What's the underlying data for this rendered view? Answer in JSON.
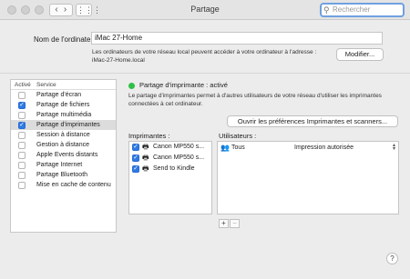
{
  "window": {
    "title": "Partage"
  },
  "search": {
    "placeholder": "Rechercher"
  },
  "computer_name": {
    "label": "Nom de l'ordinateur :",
    "value": "iMac 27-Home",
    "description_line1": "Les ordinateurs de votre réseau local peuvent accéder à votre ordinateur à l'adresse :",
    "description_line2": "iMac-27-Home.local",
    "modify_button": "Modifier..."
  },
  "services": {
    "header_active": "Activé",
    "header_service": "Service",
    "items": [
      {
        "label": "Partage d'écran",
        "checked": false,
        "selected": false
      },
      {
        "label": "Partage de fichiers",
        "checked": true,
        "selected": false
      },
      {
        "label": "Partage multimédia",
        "checked": false,
        "selected": false
      },
      {
        "label": "Partage d'imprimantes",
        "checked": true,
        "selected": true
      },
      {
        "label": "Session à distance",
        "checked": false,
        "selected": false
      },
      {
        "label": "Gestion à distance",
        "checked": false,
        "selected": false
      },
      {
        "label": "Apple Events distants",
        "checked": false,
        "selected": false
      },
      {
        "label": "Partage Internet",
        "checked": false,
        "selected": false
      },
      {
        "label": "Partage Bluetooth",
        "checked": false,
        "selected": false
      },
      {
        "label": "Mise en cache de contenu",
        "checked": false,
        "selected": false
      }
    ]
  },
  "detail": {
    "status": "Partage d'imprimante : activé",
    "status_color": "#2fbf46",
    "description": "Le partage d'imprimantes permet à d'autres utilisateurs de votre réseau d'utiliser les imprimantes connectées à cet ordinateur.",
    "open_prefs_button": "Ouvrir les préférences Imprimantes et scanners...",
    "printers_label": "Imprimantes :",
    "users_label": "Utilisateurs :",
    "printers": [
      {
        "label": "Canon MP550 s...",
        "checked": true
      },
      {
        "label": "Canon MP550 s...",
        "checked": true
      },
      {
        "label": "Send to Kindle",
        "checked": true
      }
    ],
    "users": [
      {
        "name": "Tous",
        "permission": "Impression autorisée"
      }
    ],
    "add_button": "+",
    "remove_button": "−"
  },
  "help_button": "?",
  "colors": {
    "accent": "#2f7ae5",
    "search_focus": "#6fa0df"
  }
}
